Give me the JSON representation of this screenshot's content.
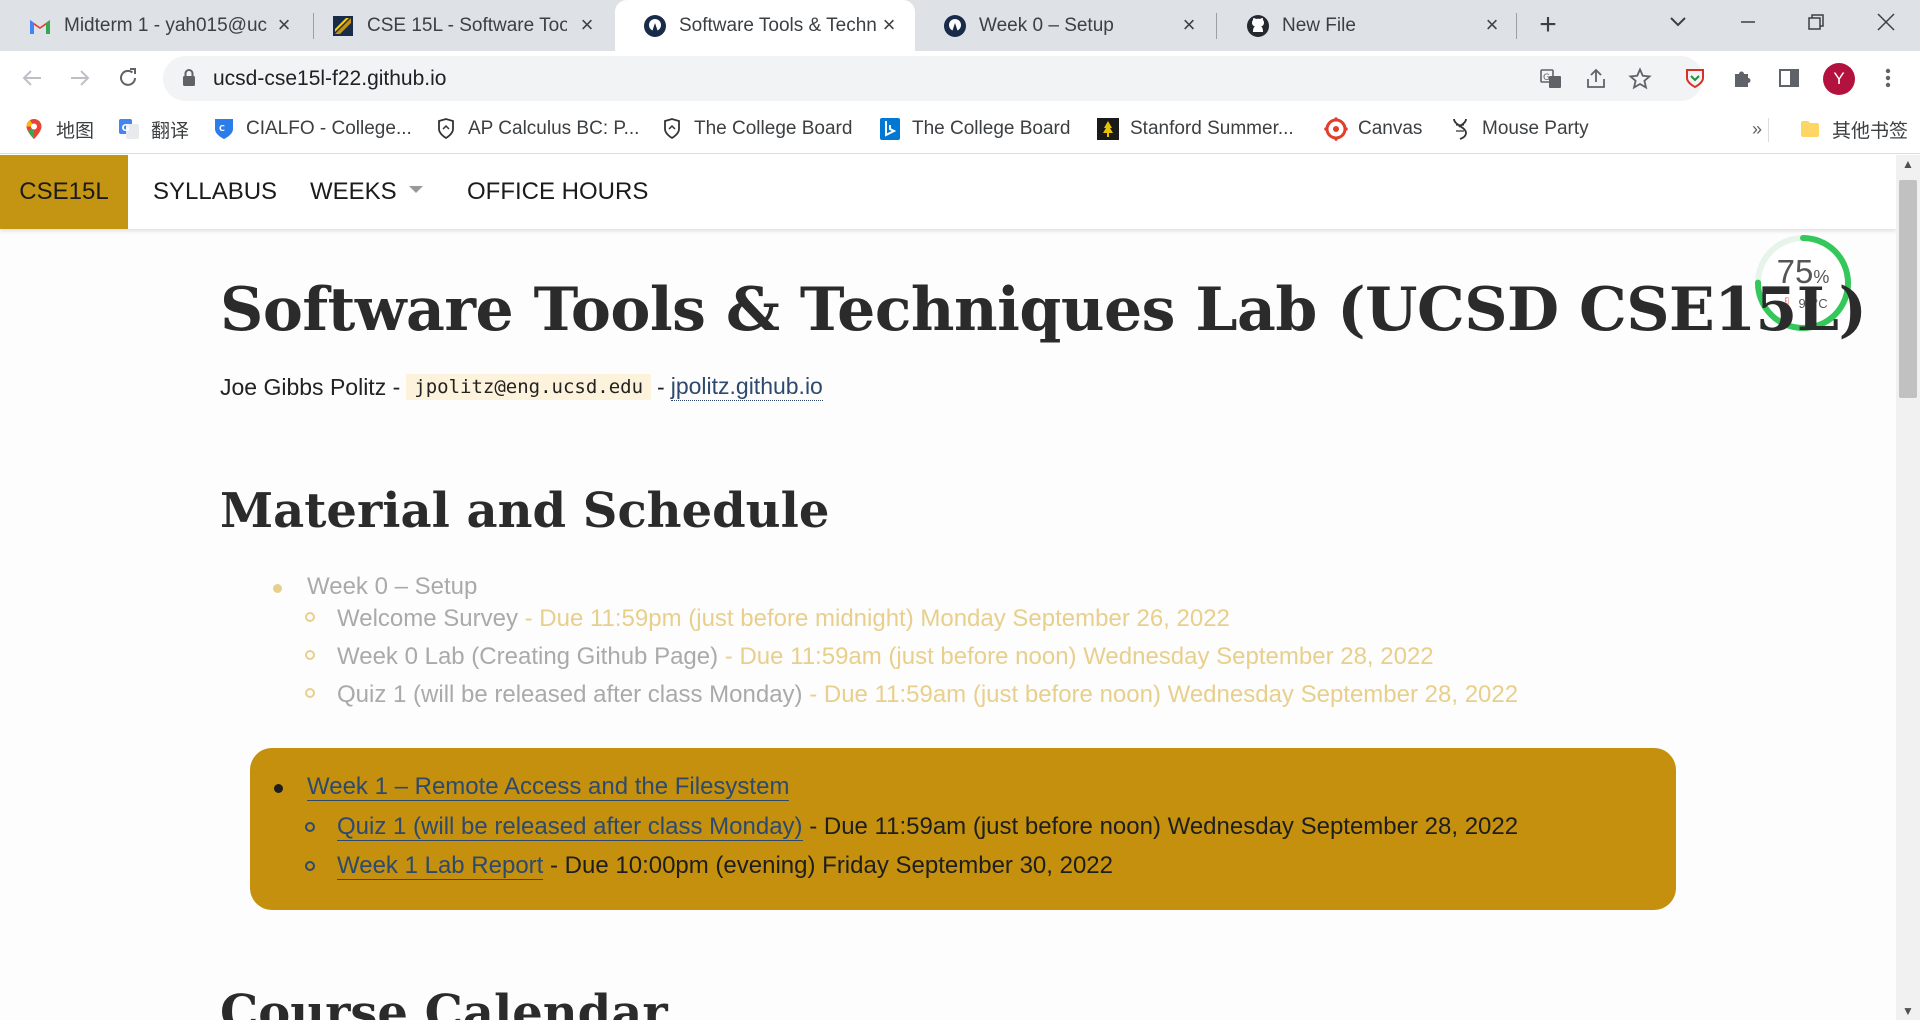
{
  "browser": {
    "tabs": [
      {
        "title": "Midterm 1 - yah015@uc",
        "icon": "gmail-icon",
        "active": false
      },
      {
        "title": "CSE 15L - Software Tool",
        "icon": "cse15l-icon",
        "active": false
      },
      {
        "title": "Software Tools & Techn",
        "icon": "ucsd-triton-icon",
        "active": true
      },
      {
        "title": "Week 0 – Setup",
        "icon": "ucsd-triton-icon",
        "active": false
      },
      {
        "title": "New File",
        "icon": "github-icon",
        "active": false
      }
    ],
    "url": "ucsd-cse15l-f22.github.io",
    "avatar_letter": "Y",
    "bookmarks": [
      {
        "label": "地图",
        "icon": "maps-pin-icon"
      },
      {
        "label": "翻译",
        "icon": "translate-icon"
      },
      {
        "label": "CIALFO - College...",
        "icon": "cialfo-shield-icon"
      },
      {
        "label": "AP Calculus BC: P...",
        "icon": "ap-shield-icon"
      },
      {
        "label": "The College Board",
        "icon": "college-board-shield-icon"
      },
      {
        "label": "The College Board",
        "icon": "bing-icon"
      },
      {
        "label": "Stanford Summer...",
        "icon": "stanford-tree-icon"
      },
      {
        "label": "Canvas",
        "icon": "canvas-icon"
      },
      {
        "label": "Mouse Party",
        "icon": "dna-icon"
      }
    ],
    "more_bookmarks": "»",
    "other_bookmarks": "其他书签"
  },
  "site_nav": {
    "brand": "CSE15L",
    "links": [
      "SYLLABUS",
      "WEEKS",
      "OFFICE HOURS"
    ]
  },
  "gauge": {
    "percent": "75",
    "percent_sign": "%",
    "temp": "93°C",
    "value": 0.75
  },
  "page": {
    "title": "Software Tools & Techniques Lab (UCSD CSE15L)",
    "author": "Joe Gibbs Politz -",
    "email": "jpolitz@eng.ucsd.edu",
    "sep": "-",
    "site_link": "jpolitz.github.io",
    "section_title": "Material and Schedule",
    "next_section": "Course Calendar"
  },
  "weeks": [
    {
      "title": "Week 0 – Setup",
      "items": [
        {
          "link": "Welcome Survey",
          "due": " - Due 11:59pm (just before midnight) Monday September 26, 2022"
        },
        {
          "link": "Week 0 Lab (Creating Github Page)",
          "due": " - Due 11:59am (just before noon) Wednesday September 28, 2022"
        },
        {
          "link": "Quiz 1 (will be released after class Monday)",
          "due": " - Due 11:59am (just before noon) Wednesday September 28, 2022"
        }
      ]
    },
    {
      "title": "Week 1 – Remote Access and the Filesystem",
      "items": [
        {
          "link": "Quiz 1 (will be released after class Monday)",
          "due": " - Due 11:59am (just before noon) Wednesday September 28, 2022"
        },
        {
          "link": "Week 1 Lab Report",
          "due": " - Due 10:00pm (evening) Friday September 30, 2022"
        }
      ]
    }
  ]
}
